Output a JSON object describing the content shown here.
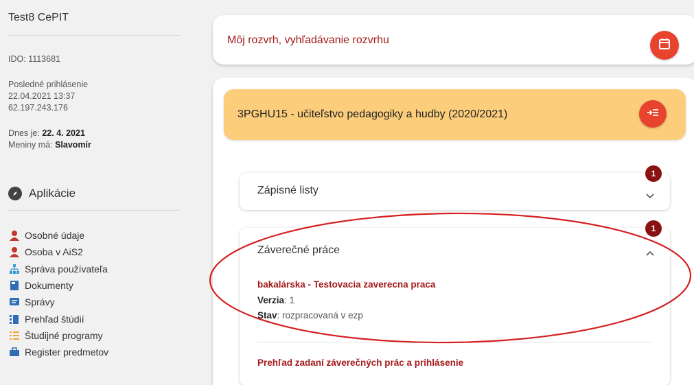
{
  "sidebar": {
    "title": "Test8 CePIT",
    "ido": "IDO: 1113681",
    "last_login_label": "Posledné prihlásenie",
    "last_login_date": "22.04.2021 13:37",
    "last_login_ip": "62.197.243.176",
    "today_label": "Dnes je: ",
    "today_value": "22. 4. 2021",
    "nameday_label": "Meniny má: ",
    "nameday_value": "Slavomír",
    "apps_heading": "Aplikácie",
    "items": [
      {
        "label": "Osobné údaje",
        "icon": "person-icon"
      },
      {
        "label": "Osoba v AiS2",
        "icon": "person-icon"
      },
      {
        "label": "Správa používateľa",
        "icon": "org-chart-icon"
      },
      {
        "label": "Dokumenty",
        "icon": "document-icon"
      },
      {
        "label": "Správy",
        "icon": "message-icon"
      },
      {
        "label": "Prehľad štúdií",
        "icon": "list-icon"
      },
      {
        "label": "Študijné programy",
        "icon": "list-icon"
      },
      {
        "label": "Register predmetov",
        "icon": "briefcase-icon"
      }
    ]
  },
  "schedule": {
    "label": "Môj rozvrh, vyhľadávanie rozvrhu",
    "icon": "calendar-icon"
  },
  "study": {
    "label": "3PGHU15 - učiteľstvo pedagogiky a hudby (2020/2021)",
    "icon": "enter-list-icon"
  },
  "accordion": {
    "enrollment": {
      "title": "Zápisné listy",
      "badge": "1",
      "state": "collapsed"
    },
    "theses": {
      "title": "Záverečné práce",
      "badge": "1",
      "state": "expanded",
      "thesis_title": "bakalárska - Testovacia zaverecna praca",
      "version_label": "Verzia",
      "version_value": ": 1",
      "status_label": "Stav",
      "status_value": ": rozpracovaná v ezp",
      "overview_link": "Prehľad zadaní záverečných prác a prihlásenie"
    }
  },
  "colors": {
    "accent_red": "#e8432c",
    "link_red": "#a41a1a",
    "badge_red": "#8a1212",
    "study_bar": "#fcce7c",
    "annotation_ellipse": "#d61f1f"
  }
}
